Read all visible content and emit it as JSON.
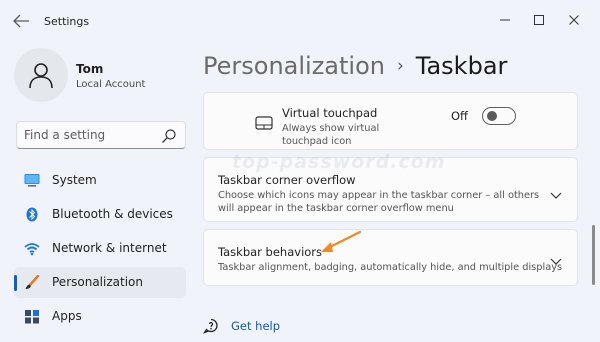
{
  "window": {
    "title": "Settings"
  },
  "user": {
    "name": "Tom",
    "account_type": "Local Account"
  },
  "search": {
    "placeholder": "Find a setting"
  },
  "sidebar": {
    "items": [
      {
        "label": "System",
        "icon": "system-icon"
      },
      {
        "label": "Bluetooth & devices",
        "icon": "bluetooth-icon"
      },
      {
        "label": "Network & internet",
        "icon": "wifi-icon"
      },
      {
        "label": "Personalization",
        "icon": "brush-icon",
        "selected": true
      },
      {
        "label": "Apps",
        "icon": "apps-icon"
      }
    ]
  },
  "breadcrumb": {
    "parent": "Personalization",
    "separator": "›",
    "current": "Taskbar"
  },
  "settings": {
    "touchpad": {
      "title": "Virtual touchpad",
      "description": "Always show virtual touchpad icon",
      "toggle_state": "Off",
      "icon": "touchpad-icon"
    },
    "corner_overflow": {
      "title": "Taskbar corner overflow",
      "description": "Choose which icons may appear in the taskbar corner – all others will appear in the taskbar corner overflow menu"
    },
    "behaviors": {
      "title": "Taskbar behaviors",
      "description": "Taskbar alignment, badging, automatically hide, and multiple displays"
    }
  },
  "help": {
    "label": "Get help"
  },
  "watermark": {
    "text": "top-password.com"
  },
  "colors": {
    "accent": "#0f5fbf",
    "annotation_arrow": "#f08a24",
    "link": "#0b5cad"
  }
}
